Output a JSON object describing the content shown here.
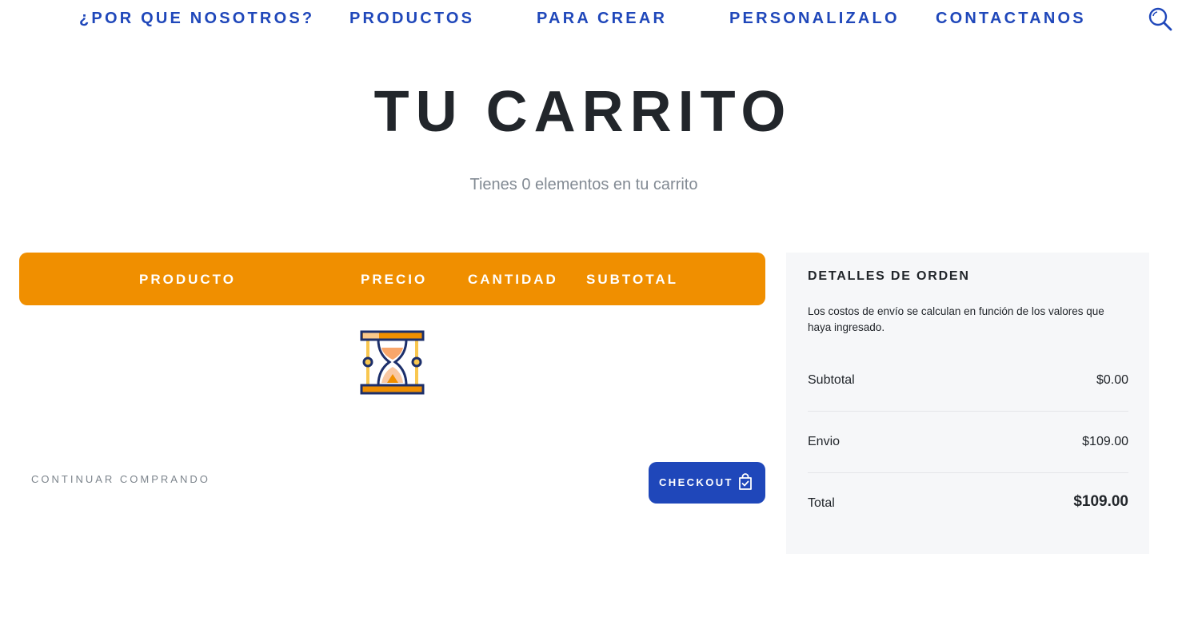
{
  "nav": {
    "items": [
      {
        "label": "¿POR QUE NOSOTROS?"
      },
      {
        "label": "PRODUCTOS"
      },
      {
        "label": "PARA CREAR"
      },
      {
        "label": "PERSONALIZALO"
      },
      {
        "label": "CONTACTANOS"
      }
    ],
    "search_icon": "search-icon"
  },
  "page": {
    "title": "TU CARRITO",
    "subtitle": "Tienes 0 elementos en tu carrito"
  },
  "cart": {
    "columns": [
      "PRODUCTO",
      "PRECIO",
      "CANTIDAD",
      "SUBTOTAL"
    ],
    "loading_icon": "hourglass-icon",
    "continue_label": "CONTINUAR COMPRANDO",
    "checkout_label": "CHECKOUT",
    "checkout_icon": "shopping-bag-check-icon"
  },
  "order": {
    "title": "DETALLES DE ORDEN",
    "description": "Los costos de envío se calculan en función de los valores que haya ingresado.",
    "subtotal_label": "Subtotal",
    "subtotal_value": "$0.00",
    "shipping_label": "Envio",
    "shipping_value": "$109.00",
    "total_label": "Total",
    "total_value": "$109.00"
  },
  "colors": {
    "brand_blue": "#1f47ba",
    "accent_orange": "#f08f00",
    "panel_bg": "#f6f7f9",
    "text_dark": "#22262b",
    "text_muted": "#828a93"
  }
}
